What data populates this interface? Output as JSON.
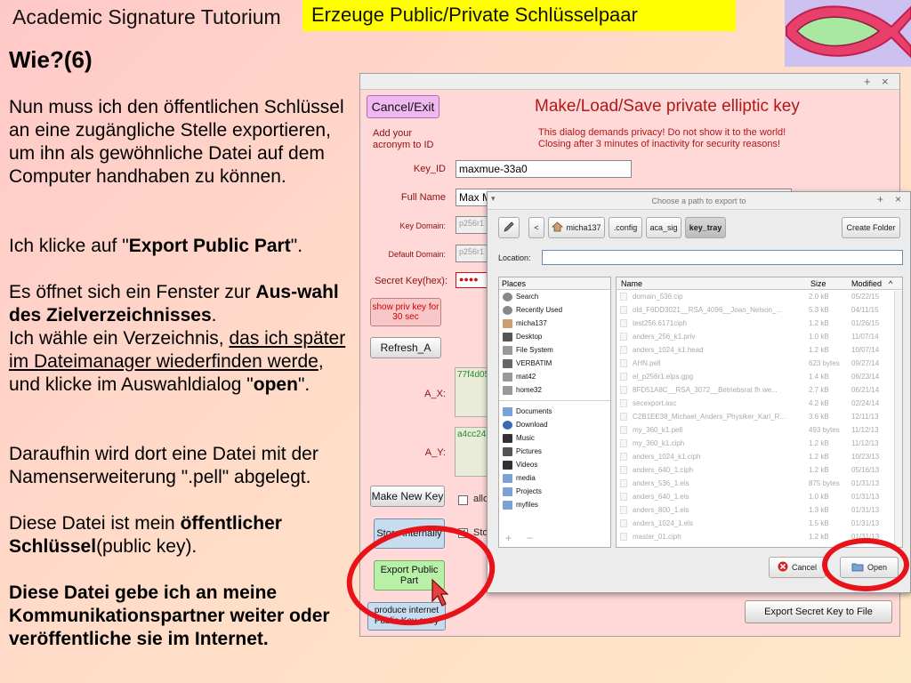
{
  "slide": {
    "title": "Academic Signature Tutorium",
    "banner": "Erzeuge Public/Private Schlüsselpaar",
    "heading": "Wie?(6)",
    "para1": "Nun muss ich den öffentlichen Schlüssel an eine zugängliche Stelle exportieren, um ihn als gewöhnliche Datei auf dem Computer handhaben zu können.",
    "para2_pre": "Ich klicke auf \"",
    "para2_bold": "Export Public Part",
    "para2_post": "\".",
    "para3_pre": "Es öffnet sich ein Fenster zur ",
    "para3_bold": "Aus-wahl des Zielverzeichnisses",
    "para3_post": ".",
    "para4_pre": "Ich wähle ein Verzeichnis, ",
    "para4_underline": "das ich später im Dateimanager wiederfinden werde",
    "para4_mid": ", und klicke im Auswahldialog \"",
    "para4_bold": "open",
    "para4_post": "\".",
    "para5": "Daraufhin wird dort eine Datei mit der Namenserweiterung \".pell\" abgelegt.",
    "para6_pre": "Diese Datei ist mein ",
    "para6_bold": "öffentlicher Schlüssel",
    "para6_post": "(public key).",
    "para7": "Diese Datei gebe ich an meine Kommunikationspartner weiter oder veröffentliche sie im Internet."
  },
  "key_dialog": {
    "titlebar_buttons": [
      "+",
      "×"
    ],
    "cancel_exit": "Cancel/Exit",
    "heading": "Make/Load/Save private elliptic key",
    "add_acronym": "Add your acronym to ID",
    "warning_line1": "This dialog demands privacy! Do not show it to the world!",
    "warning_line2": "Closing after 3 minutes of inactivity for security reasons!",
    "key_id_label": "Key_ID",
    "key_id_value": "maxmue-33a0",
    "full_name_label": "Full Name",
    "full_name_value": "Max M",
    "key_domain_label": "Key Domain:",
    "key_domain_value": "p256r1",
    "default_domain_label": "Default Domain:",
    "default_domain_value": "p256r1",
    "secret_key_label": "Secret Key(hex):",
    "secret_key_value": "●●●●",
    "show_priv_key": "show priv key for 30 sec",
    "refresh": "Refresh_A",
    "ax_label": "A_X:",
    "ax_value": "77f4d05",
    "ay_label": "A_Y:",
    "ay_value": "a4cc248",
    "make_new_key": "Make New Key",
    "allow_label": "allo",
    "store_internally": "Store internally",
    "store_label": "Sto",
    "export_public_part": "Export Public Part",
    "produce_internet": "produce internet Public Key entry",
    "export_secret_key": "Export Secret Key to File"
  },
  "chooser": {
    "title": "Choose a path to export to",
    "titlebar_buttons": [
      "+",
      "×"
    ],
    "edit_icon": "pencil-icon",
    "back_button": "<",
    "path": [
      "micha137",
      ".config",
      "aca_sig",
      "key_tray"
    ],
    "create_folder": "Create Folder",
    "location_label": "Location:",
    "location_value": "",
    "places_header": "Places",
    "places": [
      {
        "label": "Search",
        "icon": "search-icon"
      },
      {
        "label": "Recently Used",
        "icon": "clock-icon"
      },
      {
        "label": "micha137",
        "icon": "home-icon"
      },
      {
        "label": "Desktop",
        "icon": "desktop-icon"
      },
      {
        "label": "File System",
        "icon": "drive-icon"
      },
      {
        "label": "VERBATIM",
        "icon": "usb-drive-icon"
      },
      {
        "label": "mat42",
        "icon": "drive-icon"
      },
      {
        "label": "home32",
        "icon": "drive-icon"
      }
    ],
    "bookmarks": [
      {
        "label": "Documents",
        "icon": "folder-icon"
      },
      {
        "label": "Download",
        "icon": "download-icon"
      },
      {
        "label": "Music",
        "icon": "music-icon"
      },
      {
        "label": "Pictures",
        "icon": "pictures-icon"
      },
      {
        "label": "Videos",
        "icon": "videos-icon"
      },
      {
        "label": "media",
        "icon": "folder-icon"
      },
      {
        "label": "Projects",
        "icon": "folder-icon"
      },
      {
        "label": "myfiles",
        "icon": "folder-icon"
      }
    ],
    "columns": {
      "name": "Name",
      "size": "Size",
      "modified": "Modified"
    },
    "sort_indicator": "^",
    "files": [
      {
        "name": "domain_536.cip",
        "size": "2.0 kB",
        "modified": "05/22/15"
      },
      {
        "name": "old_F6DD3021__RSA_4096__Joao_Nelson_...",
        "size": "5.3 kB",
        "modified": "04/11/15"
      },
      {
        "name": "test256.6171ciph",
        "size": "1.2 kB",
        "modified": "01/26/15"
      },
      {
        "name": "anders_256_k1.priv",
        "size": "1.0 kB",
        "modified": "11/07/14"
      },
      {
        "name": "anders_1024_k1.head",
        "size": "1.2 kB",
        "modified": "10/07/14"
      },
      {
        "name": "AHN.pell",
        "size": "623 bytes",
        "modified": "09/27/14"
      },
      {
        "name": "el_p256r1.elps.gpg",
        "size": "1.4 kB",
        "modified": "06/23/14"
      },
      {
        "name": "8FD51A8C__RSA_3072__Betriebsrat fh we...",
        "size": "2.7 kB",
        "modified": "06/21/14"
      },
      {
        "name": "secexport.asc",
        "size": "4.2 kB",
        "modified": "02/24/14"
      },
      {
        "name": "C2B1EE38_Michael_Anders_Physiker_Karl_R...",
        "size": "3.6 kB",
        "modified": "12/11/13"
      },
      {
        "name": "my_360_k1.pell",
        "size": "493 bytes",
        "modified": "11/12/13"
      },
      {
        "name": "my_360_k1.ciph",
        "size": "1.2 kB",
        "modified": "11/12/13"
      },
      {
        "name": "anders_1024_k1.ciph",
        "size": "1.2 kB",
        "modified": "10/23/13"
      },
      {
        "name": "anders_640_1.ciph",
        "size": "1.2 kB",
        "modified": "05/16/13"
      },
      {
        "name": "anders_536_1.els",
        "size": "875 bytes",
        "modified": "01/31/13"
      },
      {
        "name": "anders_640_1.els",
        "size": "1.0 kB",
        "modified": "01/31/13"
      },
      {
        "name": "anders_800_1.els",
        "size": "1.3 kB",
        "modified": "01/31/13"
      },
      {
        "name": "anders_1024_1.els",
        "size": "1.5 kB",
        "modified": "01/31/13"
      },
      {
        "name": "master_01.ciph",
        "size": "1.2 kB",
        "modified": "01/31/13"
      }
    ],
    "add_bookmark": "+",
    "remove_bookmark": "−",
    "cancel": "Cancel",
    "open": "Open"
  },
  "colors": {
    "highlight_ring": "#e8121a",
    "banner": "#ffff00",
    "dialog_red_text": "#b01818"
  }
}
